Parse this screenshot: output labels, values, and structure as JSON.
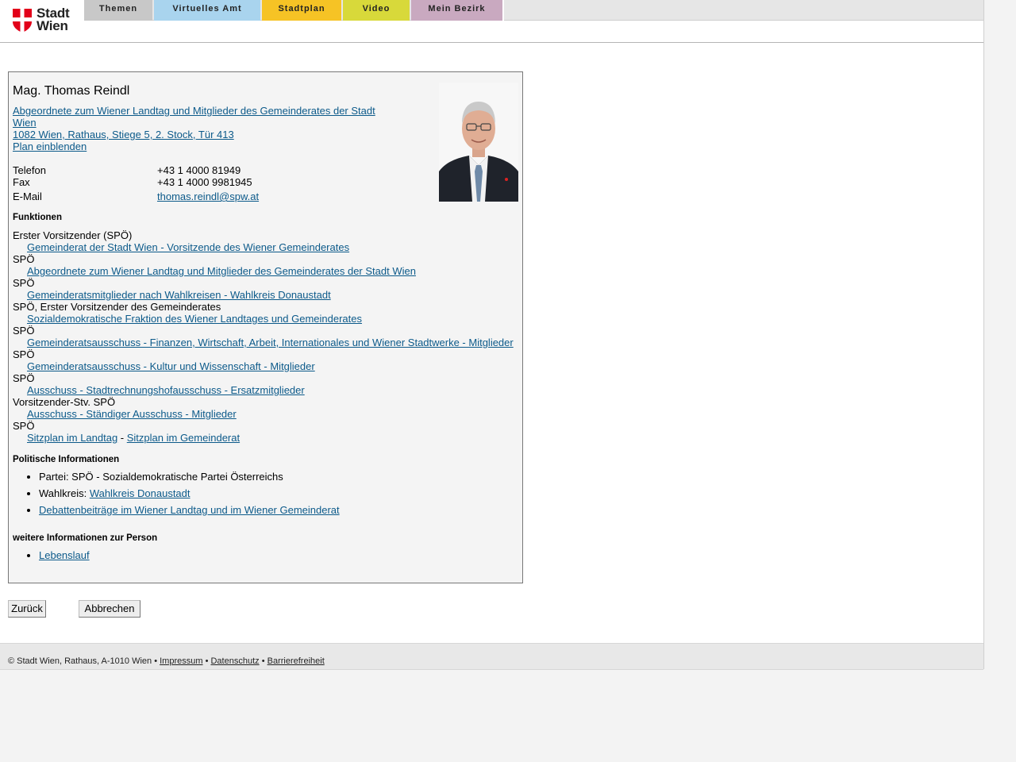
{
  "header": {
    "logo_line1": "Stadt",
    "logo_line2": "Wien",
    "nav": [
      "Themen",
      "Virtuelles Amt",
      "Stadtplan",
      "Video",
      "Mein Bezirk"
    ]
  },
  "person": {
    "name": "Mag. Thomas Reindl",
    "org_line1": "Abgeordnete zum Wiener Landtag und Mitglieder des Gemeinderates der Stadt",
    "org_line2": "Wien",
    "address": "1082 Wien, Rathaus, Stiege 5, 2. Stock, Tür 413",
    "plan_link": "Plan einblenden",
    "contact": {
      "phone_label": "Telefon",
      "phone": "+43 1 4000 81949",
      "fax_label": "Fax",
      "fax": "+43 1 4000 9981945",
      "email_label": "E-Mail",
      "email": "thomas.reindl@spw.at"
    }
  },
  "functions": {
    "heading": "Funktionen",
    "items": [
      {
        "role": "Erster Vorsitzender (SPÖ)",
        "link": "Gemeinderat der Stadt Wien - Vorsitzende des Wiener Gemeinderates"
      },
      {
        "role": "SPÖ",
        "link": "Abgeordnete zum Wiener Landtag und Mitglieder des Gemeinderates der Stadt Wien"
      },
      {
        "role": "SPÖ",
        "link": "Gemeinderatsmitglieder nach Wahlkreisen - Wahlkreis Donaustadt"
      },
      {
        "role": "SPÖ, Erster Vorsitzender des Gemeinderates",
        "link": "Sozialdemokratische Fraktion des Wiener Landtages und Gemeinderates"
      },
      {
        "role": "SPÖ",
        "link": "Gemeinderatsausschuss - Finanzen, Wirtschaft, Arbeit, Internationales und Wiener Stadtwerke - Mitglieder"
      },
      {
        "role": "SPÖ",
        "link": "Gemeinderatsausschuss - Kultur und Wissenschaft - Mitglieder"
      },
      {
        "role": "SPÖ",
        "link": "Ausschuss - Stadtrechnungshofausschuss - Ersatzmitglieder"
      },
      {
        "role": "Vorsitzender-Stv. SPÖ",
        "link": "Ausschuss - Ständiger Ausschuss - Mitglieder"
      },
      {
        "role": "SPÖ",
        "link": null
      }
    ],
    "seating_landtag": "Sitzplan im Landtag",
    "seating_sep": " - ",
    "seating_gemeinderat": "Sitzplan im Gemeinderat"
  },
  "political": {
    "heading": "Politische Informationen",
    "party": "Partei: SPÖ - Sozialdemokratische Partei Österreichs",
    "district_label": "Wahlkreis: ",
    "district_link": "Wahlkreis Donaustadt",
    "debate_link": "Debattenbeiträge im Wiener Landtag und im Wiener Gemeinderat"
  },
  "more": {
    "heading": "weitere Informationen zur Person",
    "cv_link": "Lebenslauf"
  },
  "buttons": {
    "back": "Zurück",
    "cancel": "Abbrechen"
  },
  "footer": {
    "copyright": "© Stadt Wien, Rathaus, A-1010 Wien",
    "sep": " • ",
    "impressum": "Impressum",
    "datenschutz": "Datenschutz",
    "barrierefreiheit": "Barrierefreiheit"
  },
  "colors": {
    "link": "#0c5a8a",
    "tab_themen": "#c8c8c8",
    "tab_amt": "#a9d4ee",
    "tab_stadtplan": "#f6c325",
    "tab_video": "#d8d93a",
    "tab_bezirk": "#c9a9c0",
    "logo_red": "#e2001a"
  }
}
